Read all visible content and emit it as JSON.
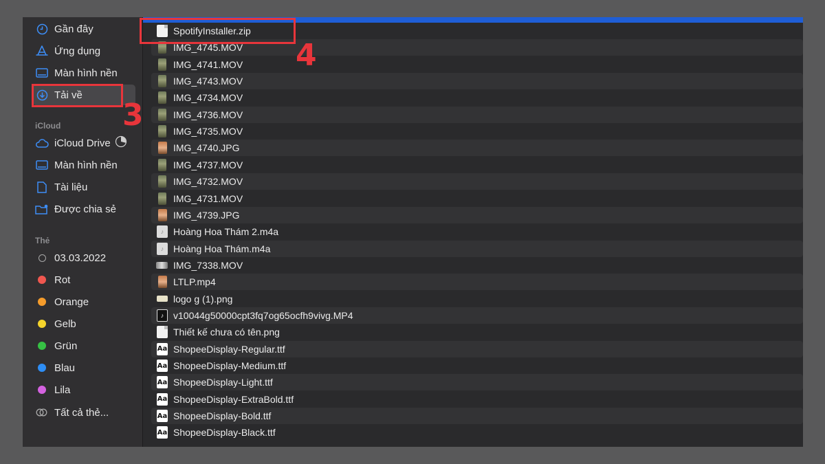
{
  "sidebar": {
    "favorites": [
      {
        "label": "Gần đây",
        "icon": "clock-icon"
      },
      {
        "label": "Ứng dụng",
        "icon": "applications-icon"
      },
      {
        "label": "Màn hình nền",
        "icon": "desktop-icon"
      },
      {
        "label": "Tải về",
        "icon": "downloads-icon",
        "active": true
      }
    ],
    "icloud_header": "iCloud",
    "icloud": [
      {
        "label": "iCloud Drive",
        "icon": "cloud-icon"
      },
      {
        "label": "Màn hình nền",
        "icon": "desktop-icon"
      },
      {
        "label": "Tài liệu",
        "icon": "document-icon"
      },
      {
        "label": "Được chia sẻ",
        "icon": "shared-folder-icon"
      }
    ],
    "tags_header": "Thẻ",
    "tags": [
      {
        "label": "03.03.2022",
        "color": "outline"
      },
      {
        "label": "Rot",
        "color": "#f0574f"
      },
      {
        "label": "Orange",
        "color": "#f59c2b"
      },
      {
        "label": "Gelb",
        "color": "#f5d42b"
      },
      {
        "label": "Grün",
        "color": "#36c144"
      },
      {
        "label": "Blau",
        "color": "#2e8ef5"
      },
      {
        "label": "Lila",
        "color": "#d462e0"
      },
      {
        "label": "Tất cả thẻ...",
        "color": "all"
      }
    ]
  },
  "files": [
    {
      "name": "SpotifyInstaller.zip",
      "kind": "doc"
    },
    {
      "name": "IMG_4745.MOV",
      "kind": "vid"
    },
    {
      "name": "IMG_4741.MOV",
      "kind": "vid"
    },
    {
      "name": "IMG_4743.MOV",
      "kind": "vid"
    },
    {
      "name": "IMG_4734.MOV",
      "kind": "vid"
    },
    {
      "name": "IMG_4736.MOV",
      "kind": "vid"
    },
    {
      "name": "IMG_4735.MOV",
      "kind": "vid"
    },
    {
      "name": "IMG_4740.JPG",
      "kind": "jpg"
    },
    {
      "name": "IMG_4737.MOV",
      "kind": "vid"
    },
    {
      "name": "IMG_4732.MOV",
      "kind": "vid"
    },
    {
      "name": "IMG_4731.MOV",
      "kind": "vid"
    },
    {
      "name": "IMG_4739.JPG",
      "kind": "jpg"
    },
    {
      "name": "Hoàng Hoa Thám 2.m4a",
      "kind": "aud"
    },
    {
      "name": "Hoàng Hoa Thám.m4a",
      "kind": "aud"
    },
    {
      "name": "IMG_7338.MOV",
      "kind": "wide"
    },
    {
      "name": "LTLP.mp4",
      "kind": "jpg"
    },
    {
      "name": "logo g (1).png",
      "kind": "png"
    },
    {
      "name": "v10044g50000cpt3fq7og65ocfh9vivg.MP4",
      "kind": "mp4b"
    },
    {
      "name": "Thiết kế chưa có tên.png",
      "kind": "doc"
    },
    {
      "name": "ShopeeDisplay-Regular.ttf",
      "kind": "font"
    },
    {
      "name": "ShopeeDisplay-Medium.ttf",
      "kind": "font"
    },
    {
      "name": "ShopeeDisplay-Light.ttf",
      "kind": "font"
    },
    {
      "name": "ShopeeDisplay-ExtraBold.ttf",
      "kind": "font"
    },
    {
      "name": "ShopeeDisplay-Bold.ttf",
      "kind": "font"
    },
    {
      "name": "ShopeeDisplay-Black.ttf",
      "kind": "font"
    }
  ],
  "font_icon_text": "Aa",
  "annotations": {
    "step3": "3",
    "step4": "4"
  },
  "colors": {
    "accent": "#1f5ed6",
    "annotation": "#e8353b"
  }
}
